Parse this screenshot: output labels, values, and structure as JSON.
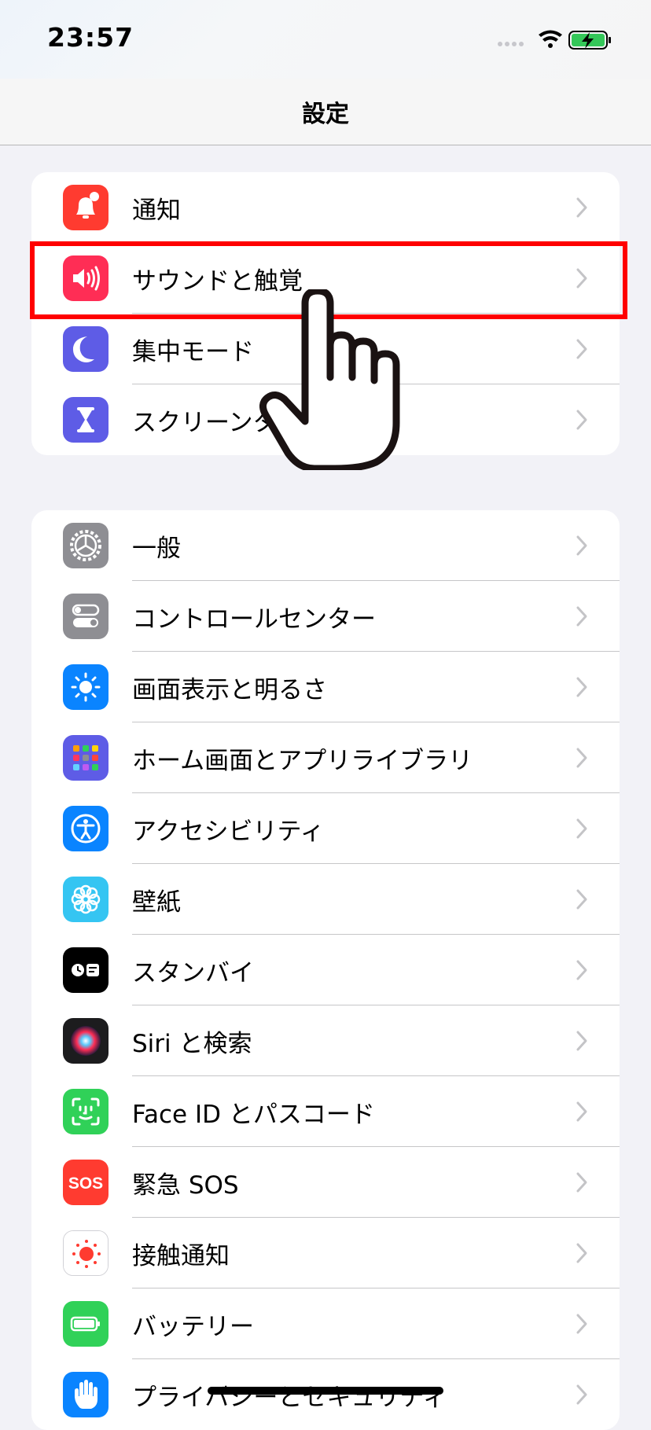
{
  "status_bar": {
    "time": "23:57",
    "wifi_icon": "wifi-icon",
    "battery_icon": "battery-charging-icon"
  },
  "header": {
    "title": "設定"
  },
  "group1": {
    "items": [
      {
        "label": "通知",
        "icon": "notification-bell-icon",
        "color": "#ff3b30"
      },
      {
        "label": "サウンドと触覚",
        "icon": "speaker-icon",
        "color": "#ff2d55"
      },
      {
        "label": "集中モード",
        "icon": "moon-icon",
        "color": "#5e5ce6"
      },
      {
        "label": "スクリーンタイム",
        "icon": "hourglass-icon",
        "color": "#5e5ce6"
      }
    ]
  },
  "group2": {
    "items": [
      {
        "label": "一般",
        "icon": "gear-icon",
        "color": "#8e8e93"
      },
      {
        "label": "コントロールセンター",
        "icon": "toggles-icon",
        "color": "#8e8e93"
      },
      {
        "label": "画面表示と明るさ",
        "icon": "sun-icon",
        "color": "#0a84ff"
      },
      {
        "label": "ホーム画面とアプリライブラリ",
        "icon": "app-grid-icon",
        "color": "#5e5ce6"
      },
      {
        "label": "アクセシビリティ",
        "icon": "accessibility-icon",
        "color": "#0a84ff"
      },
      {
        "label": "壁紙",
        "icon": "flower-icon",
        "color": "#35c5f2"
      },
      {
        "label": "スタンバイ",
        "icon": "standby-icon",
        "color": "#000000"
      },
      {
        "label": "Siri と検索",
        "icon": "siri-icon",
        "color": "#1c1c1e"
      },
      {
        "label": "Face ID とパスコード",
        "icon": "face-id-icon",
        "color": "#30d158"
      },
      {
        "label": "緊急 SOS",
        "icon": "sos-icon",
        "color": "#ff3b30"
      },
      {
        "label": "接触通知",
        "icon": "exposure-notification-icon",
        "color": "#ffffff"
      },
      {
        "label": "バッテリー",
        "icon": "battery-icon",
        "color": "#30d158"
      },
      {
        "label": "プライバシーとセキュリティ",
        "icon": "hand-raised-icon",
        "color": "#0a84ff"
      }
    ]
  },
  "highlight": {
    "color": "#ff0000"
  },
  "pointer": {
    "icon": "pointing-hand-icon"
  }
}
